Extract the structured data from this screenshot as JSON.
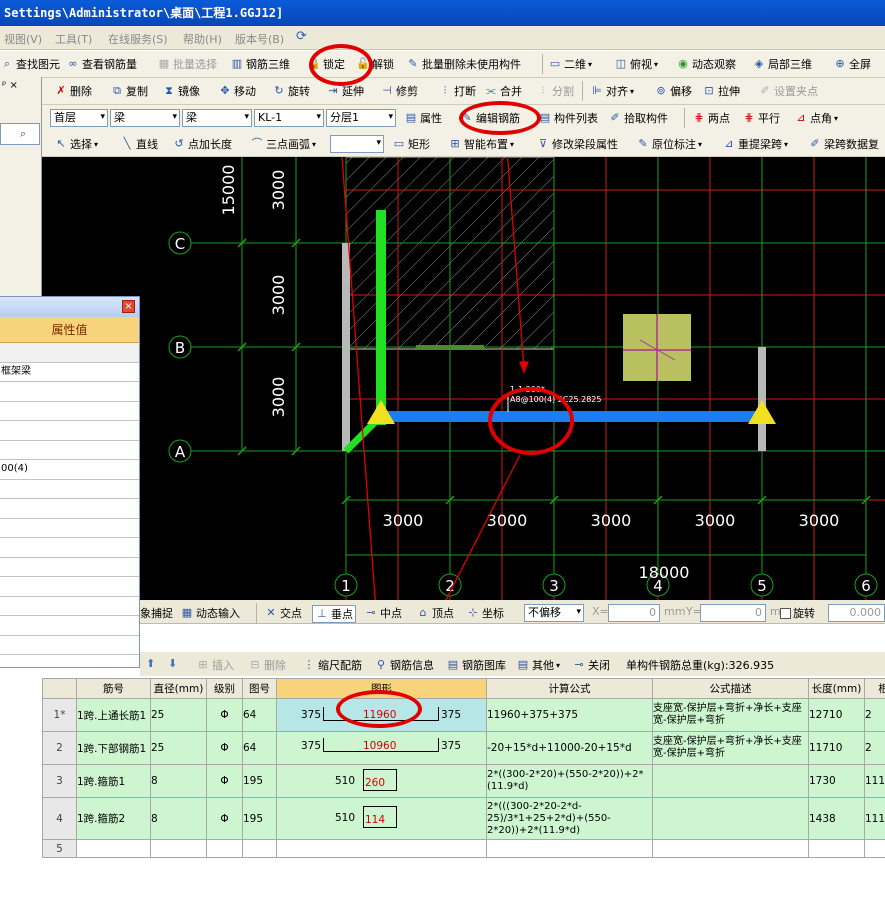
{
  "window": {
    "title": "Settings\\Administrator\\桌面\\工程1.GGJ12]"
  },
  "menu": [
    "视图(V)",
    "工具(T)",
    "在线服务(S)",
    "帮助(H)",
    "版本号(B)"
  ],
  "toolbar1": {
    "find_element": "查找图元",
    "view_rebar_qty": "查看钢筋量",
    "batch_select": "批量选择",
    "rebar_3d": "钢筋三维",
    "lock": "锁定",
    "unlock": "解锁",
    "batch_delete_unused": "批量删除未使用构件",
    "view_2d": "二维",
    "top_view": "俯视",
    "dynamic_view": "动态观察",
    "local_3d": "局部三维",
    "full_screen": "全屏"
  },
  "toolbar2": {
    "delete": "删除",
    "copy": "复制",
    "mirror": "镜像",
    "move": "移动",
    "rotate": "旋转",
    "extend": "延伸",
    "trim": "修剪",
    "break": "打断",
    "merge": "合并",
    "split": "分割",
    "align": "对齐",
    "offset": "偏移",
    "stretch": "拉伸",
    "set_grip": "设置夹点"
  },
  "toolbar3": {
    "floor": "首层",
    "category": "梁",
    "type": "梁",
    "member": "KL-1",
    "layer": "分层1",
    "properties": "属性",
    "edit_rebar": "编辑钢筋",
    "member_list": "构件列表",
    "pick_member": "拾取构件",
    "two_points": "两点",
    "parallel": "平行",
    "point_angle": "点角"
  },
  "toolbar4": {
    "select": "选择",
    "line": "直线",
    "point_length": "点加长度",
    "arc3": "三点画弧",
    "rect": "矩形",
    "smart_layout": "智能布置",
    "modify_span_props": "修改梁段属性",
    "original_mark": "原位标注",
    "reextract_span": "重提梁跨",
    "copy_span_data": "梁跨数据复"
  },
  "drawing": {
    "axes_letters": [
      "C",
      "B",
      "A"
    ],
    "axes_numbers": [
      "1",
      "2",
      "3",
      "4",
      "5",
      "6"
    ],
    "left_dims": [
      "15000",
      "3000",
      "3000",
      "3000"
    ],
    "bottom_dims": [
      "3000",
      "3000",
      "3000",
      "3000",
      "3000"
    ],
    "total_dim": "18000",
    "beam_label_line1": "1-1 300*",
    "beam_label_line2": "A8@100(4) 2C25.2825"
  },
  "snap_bar": {
    "capture": "象捕捉",
    "dynamic_input": "动态输入",
    "intersection": "交点",
    "perpendicular": "垂点",
    "midpoint": "中点",
    "vertex": "顶点",
    "coordinate": "坐标",
    "offset_mode": "不偏移",
    "x_label": "X=",
    "x_value": "0",
    "y_label": "Y=",
    "y_value": "0",
    "unit": "mm",
    "rotate": "旋转",
    "rotate_value": "0.000"
  },
  "property_panel": {
    "column_header": "属性值",
    "rows": [
      "",
      "框架梁",
      "",
      "",
      "",
      "",
      "00(4)",
      "",
      "",
      "",
      "",
      "",
      "",
      "",
      "",
      ""
    ]
  },
  "rebar_toolbar": {
    "insert": "插入",
    "delete": "删除",
    "scale_rebar": "缩尺配筋",
    "rebar_info": "钢筋信息",
    "rebar_library": "钢筋图库",
    "other": "其他",
    "close": "关闭",
    "total_weight_label": "单构件钢筋总重(kg):326.935"
  },
  "rebar_table": {
    "headers": [
      "",
      "筋号",
      "直径(mm)",
      "级别",
      "图号",
      "图形",
      "计算公式",
      "公式描述",
      "长度(mm)",
      "根"
    ],
    "rows": [
      {
        "idx": "1*",
        "name": "1跨.上通长筋1",
        "dia": "25",
        "grade": "Φ",
        "fig": "64",
        "shape_left": "375",
        "shape_mid": "11960",
        "shape_right": "375",
        "formula": "11960+375+375",
        "desc": "支座宽-保护层+弯折+净长+支座宽-保护层+弯折",
        "len": "12710",
        "count": "2"
      },
      {
        "idx": "2",
        "name": "1跨.下部钢筋1",
        "dia": "25",
        "grade": "Φ",
        "fig": "64",
        "shape_left": "375",
        "shape_mid": "10960",
        "shape_right": "375",
        "formula": "-20+15*d+11000-20+15*d",
        "desc": "支座宽-保护层+弯折+净长+支座宽-保护层+弯折",
        "len": "11710",
        "count": "2"
      },
      {
        "idx": "3",
        "name": "1跨.箍筋1",
        "dia": "8",
        "grade": "Φ",
        "fig": "195",
        "shape_left": "510",
        "shape_mid": "260",
        "shape_right": "",
        "formula": "2*((300-2*20)+(550-2*20))+2*(11.9*d)",
        "desc": "",
        "len": "1730",
        "count": "111"
      },
      {
        "idx": "4",
        "name": "1跨.箍筋2",
        "dia": "8",
        "grade": "Φ",
        "fig": "195",
        "shape_left": "510",
        "shape_mid": "114",
        "shape_right": "",
        "formula": "2*(((300-2*20-2*d-25)/3*1+25+2*d)+(550-2*20))+2*(11.9*d)",
        "desc": "",
        "len": "1438",
        "count": "111"
      },
      {
        "idx": "5",
        "name": "",
        "dia": "",
        "grade": "",
        "fig": "",
        "shape_left": "",
        "shape_mid": "",
        "shape_right": "",
        "formula": "",
        "desc": "",
        "len": "",
        "count": ""
      }
    ]
  }
}
